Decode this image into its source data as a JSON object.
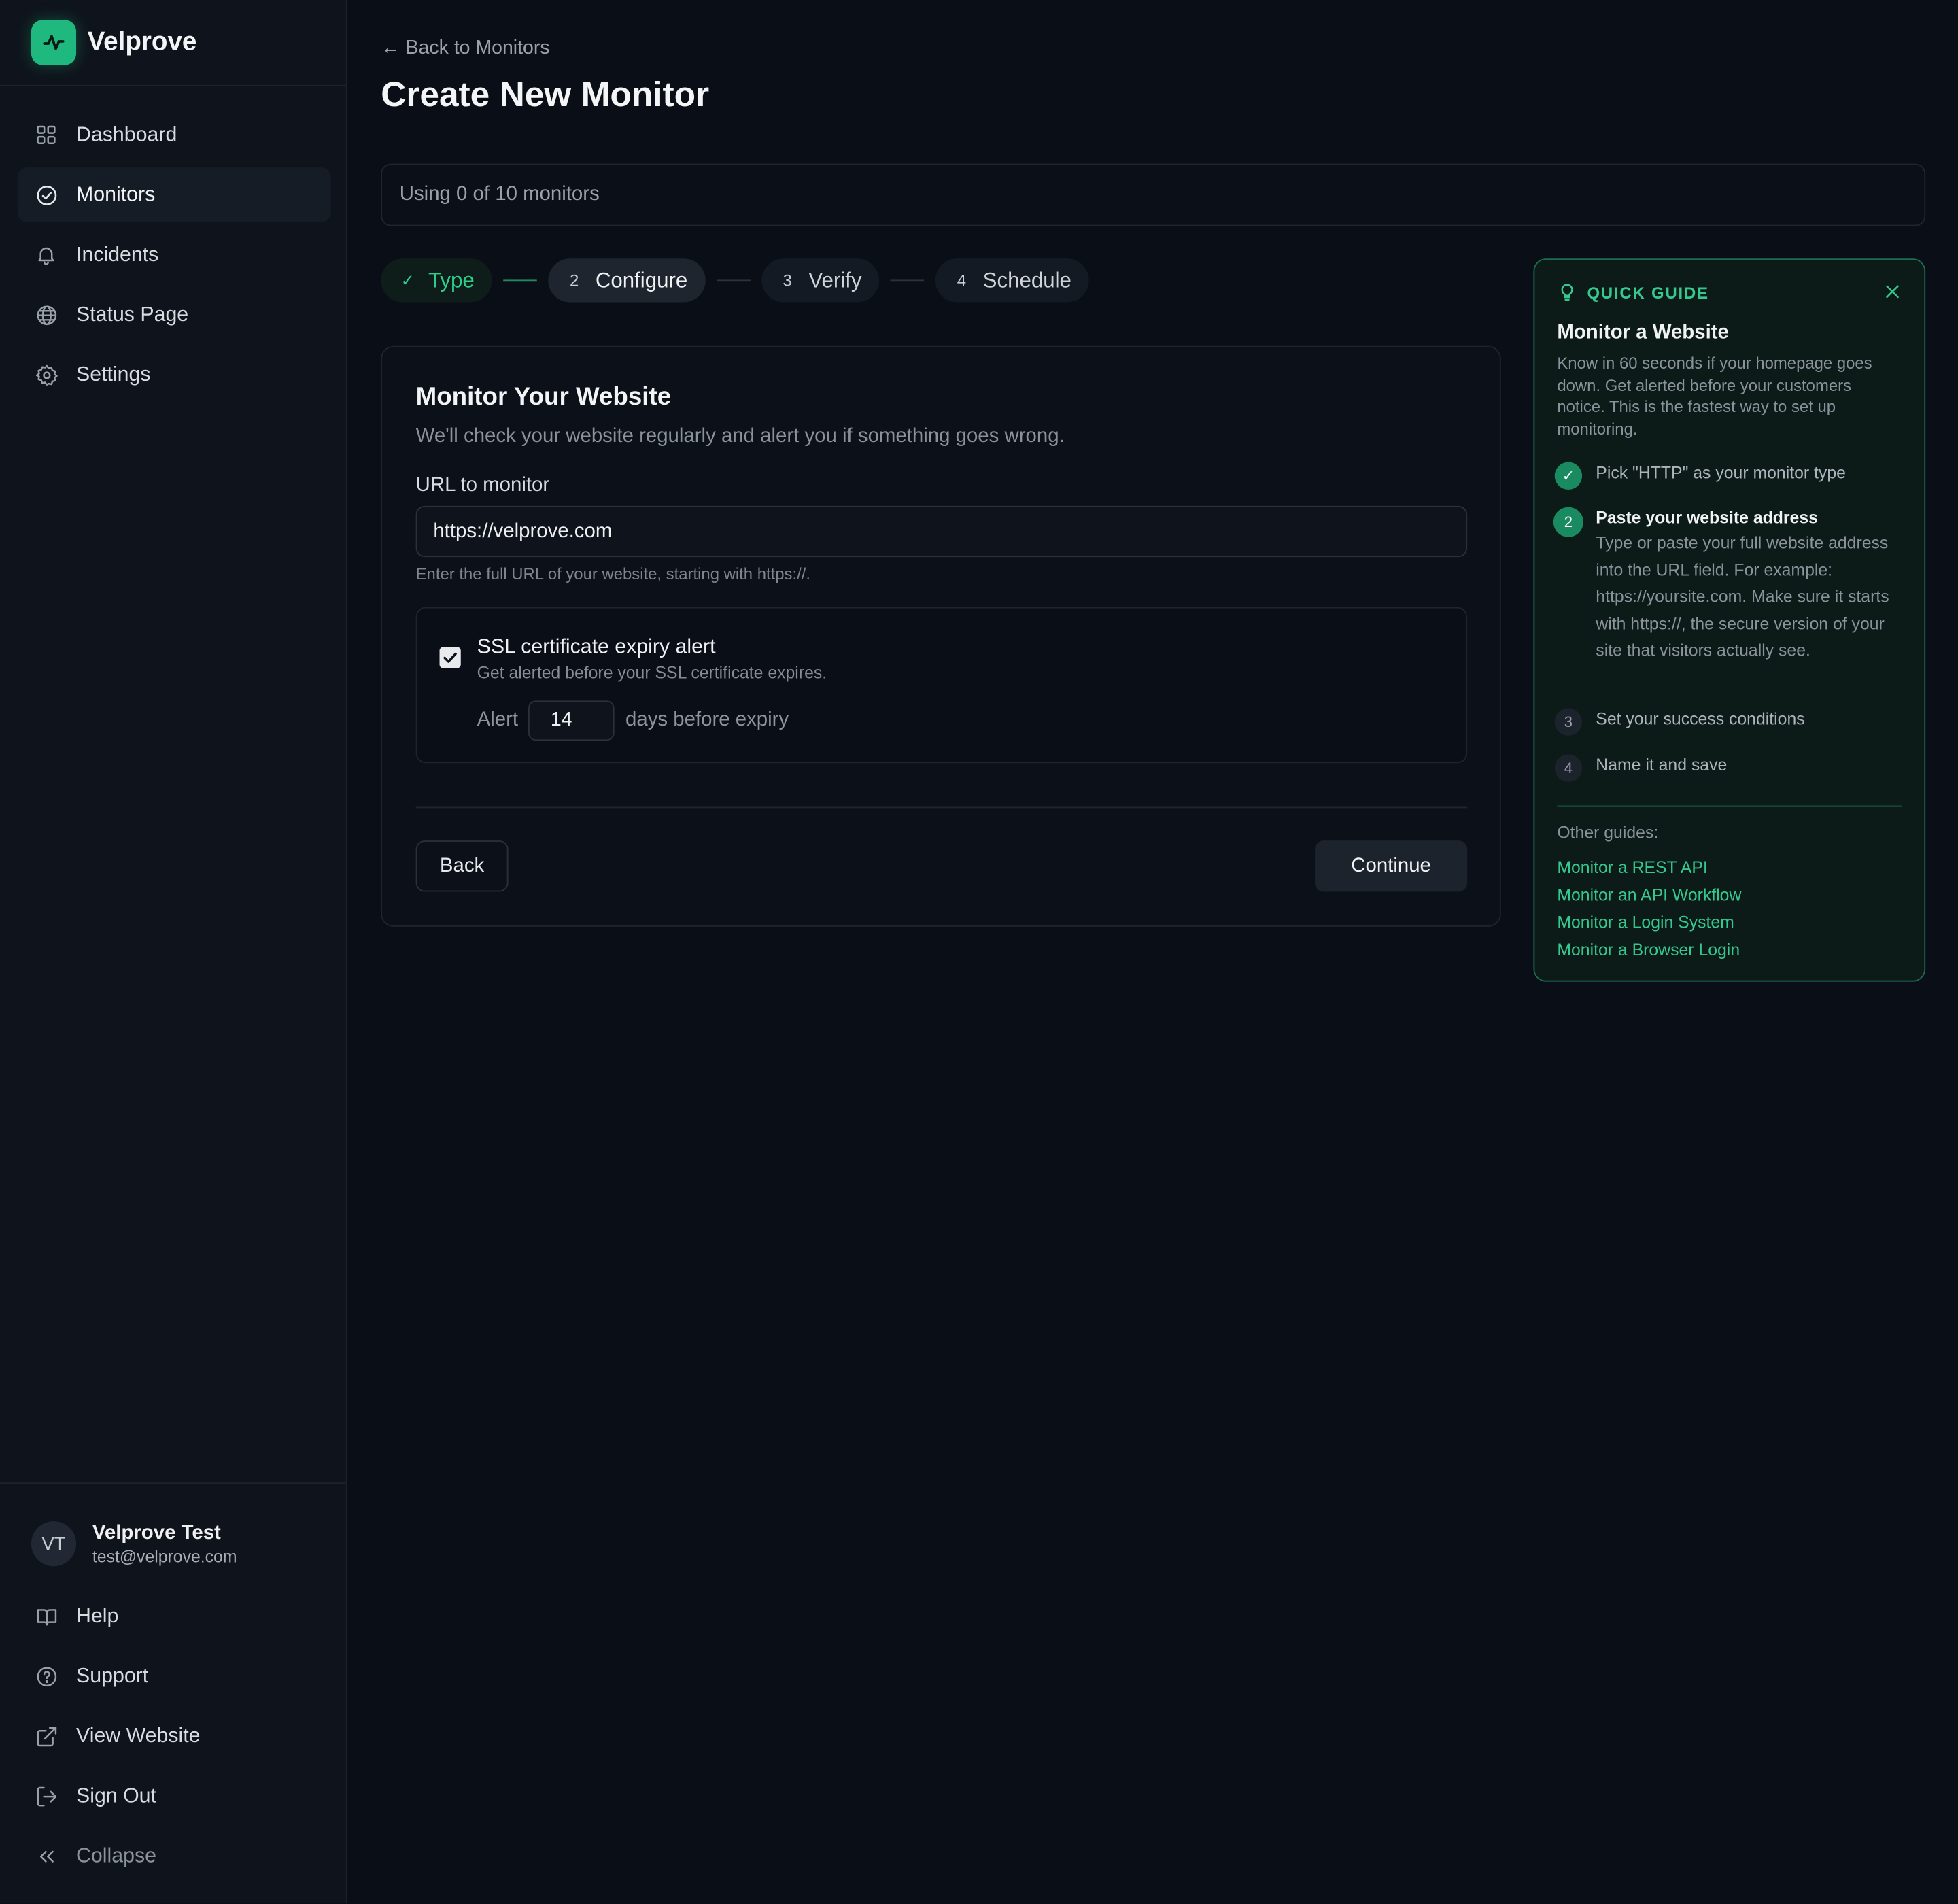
{
  "brand": {
    "name": "Velprove",
    "accent": "#1fb97f"
  },
  "sidebar": {
    "items": [
      {
        "label": "Dashboard",
        "icon": "dashboard-icon"
      },
      {
        "label": "Monitors",
        "icon": "check-circle-icon",
        "active": true
      },
      {
        "label": "Incidents",
        "icon": "bell-icon"
      },
      {
        "label": "Status Page",
        "icon": "globe-icon"
      },
      {
        "label": "Settings",
        "icon": "gear-icon"
      }
    ],
    "user": {
      "initials": "VT",
      "name": "Velprove Test",
      "email": "test@velprove.com"
    },
    "bottom_items": [
      {
        "label": "Help",
        "icon": "book-icon"
      },
      {
        "label": "Support",
        "icon": "help-circle-icon"
      },
      {
        "label": "View Website",
        "icon": "external-link-icon"
      },
      {
        "label": "Sign Out",
        "icon": "sign-out-icon"
      },
      {
        "label": "Collapse",
        "icon": "chevrons-left-icon"
      }
    ]
  },
  "header": {
    "back_link": "← Back to Monitors",
    "title": "Create New Monitor",
    "usage": "Using 0 of 10 monitors"
  },
  "steps": [
    {
      "num": "✓",
      "label": "Type",
      "state": "done"
    },
    {
      "num": "2",
      "label": "Configure",
      "state": "active"
    },
    {
      "num": "3",
      "label": "Verify",
      "state": "pending"
    },
    {
      "num": "4",
      "label": "Schedule",
      "state": "pending"
    }
  ],
  "form": {
    "title": "Monitor Your Website",
    "subtitle": "We'll check your website regularly and alert you if something goes wrong.",
    "url_label": "URL to monitor",
    "url_value": "https://velprove.com",
    "url_help": "Enter the full URL of your website, starting with https://.",
    "ssl": {
      "checked": true,
      "title": "SSL certificate expiry alert",
      "subtitle": "Get alerted before your SSL certificate expires.",
      "alert_prefix": "Alert",
      "days_value": "14",
      "alert_suffix": "days before expiry"
    },
    "back_label": "Back",
    "continue_label": "Continue"
  },
  "guide": {
    "heading": "QUICK GUIDE",
    "title": "Monitor a Website",
    "description": "Know in 60 seconds if your homepage goes down. Get alerted before your customers notice. This is the fastest way to set up monitoring.",
    "steps": [
      {
        "num": "✓",
        "text": "Pick \"HTTP\" as your monitor type",
        "state": "done"
      },
      {
        "num": "2",
        "text": "Paste your website address",
        "detail": "Type or paste your full website address into the URL field. For example: https://yoursite.com. Make sure it starts with https://, the secure version of your site that visitors actually see.",
        "state": "current"
      },
      {
        "num": "3",
        "text": "Set your success conditions",
        "state": "pending"
      },
      {
        "num": "4",
        "text": "Name it and save",
        "state": "pending"
      }
    ],
    "other_label": "Other guides:",
    "other_links": [
      "Monitor a REST API",
      "Monitor an API Workflow",
      "Monitor a Login System",
      "Monitor a Browser Login"
    ]
  }
}
